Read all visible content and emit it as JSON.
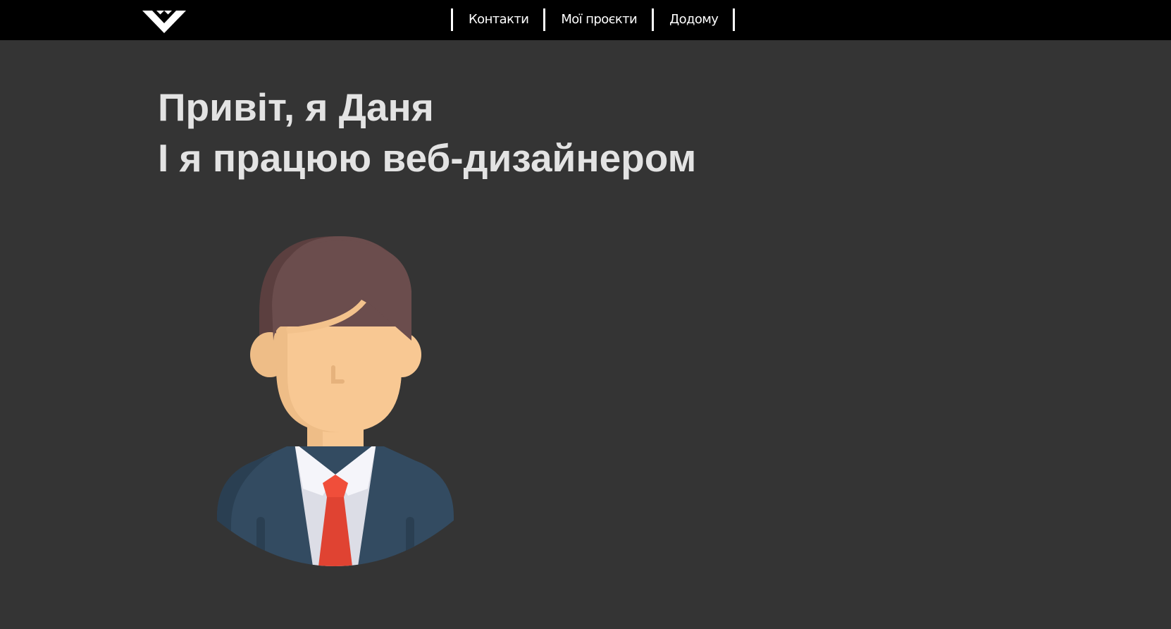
{
  "header": {
    "logo_icon": "w-chevron-logo-icon",
    "nav": [
      {
        "label": "Контакти"
      },
      {
        "label": "Мої проєкти"
      },
      {
        "label": "Додому"
      }
    ]
  },
  "hero": {
    "line1": "Привіт, я Даня",
    "line2": "І я працюю веб-дизайнером"
  },
  "avatar": {
    "icon": "businessman-avatar-icon"
  },
  "colors": {
    "page_background": "#343434",
    "header_background": "#000000",
    "nav_text": "#ffffff",
    "hero_text": "#e3e3e3",
    "suit": "#334b61",
    "tie": "#e04332",
    "hair": "#6b4d4d",
    "skin": "#f8c893"
  }
}
